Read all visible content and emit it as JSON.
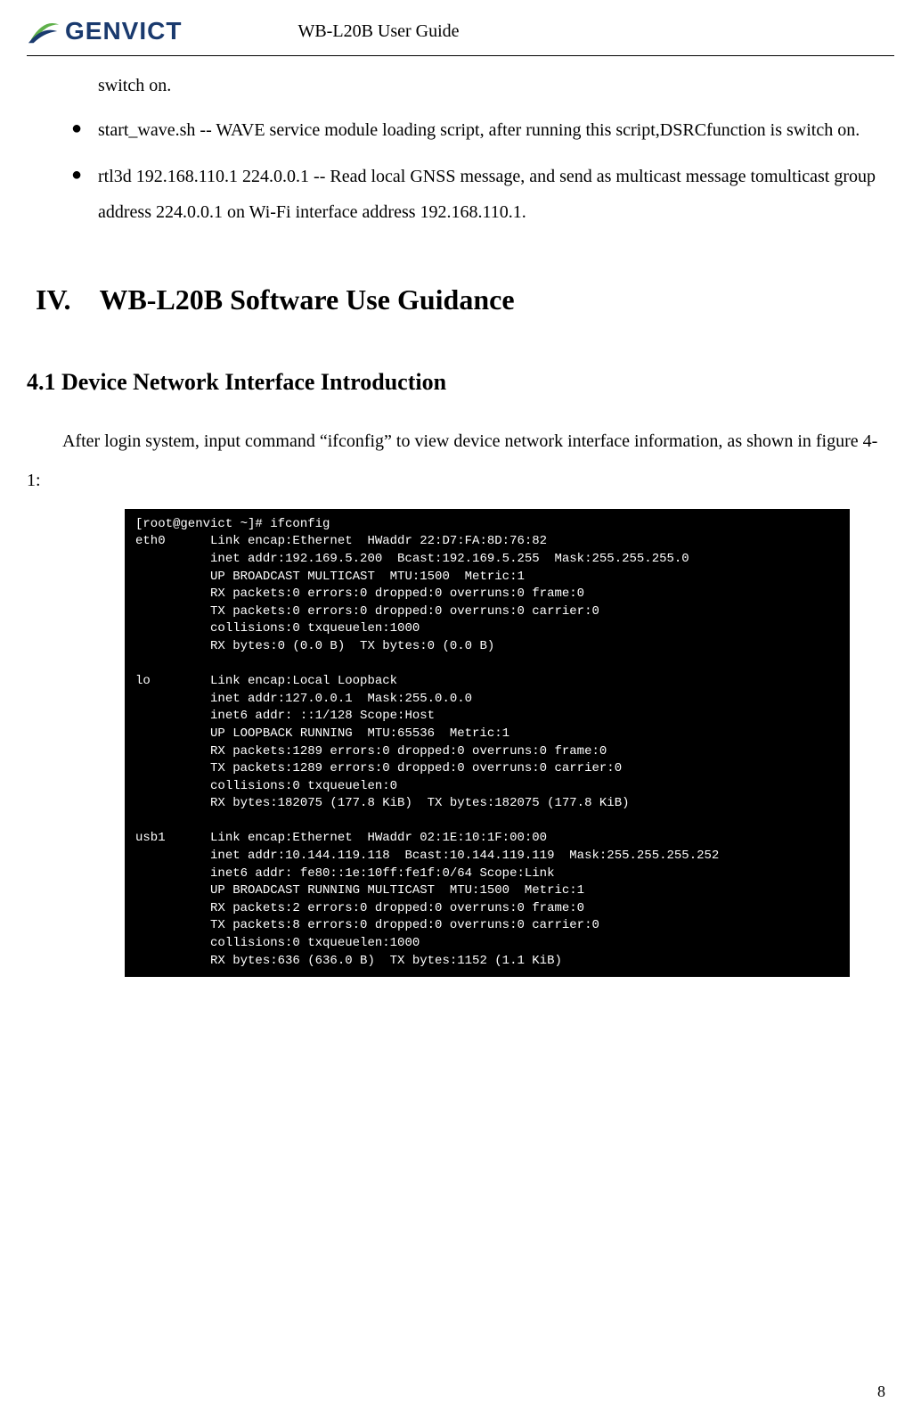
{
  "header": {
    "logo_text": "GENVICT",
    "doc_title": "WB-L20B User Guide"
  },
  "body": {
    "orphan": "switch on.",
    "bullets": [
      "start_wave.sh -- WAVE service module loading script, after running this script,DSRCfunction is switch on.",
      "rtl3d 192.168.110.1 224.0.0.1 -- Read local GNSS message, and send as multicast message tomulticast group address 224.0.0.1 on Wi-Fi interface address 192.168.110.1."
    ],
    "section_heading": "IV. WB-L20B Software Use Guidance",
    "subsection_heading": "4.1 Device Network Interface Introduction",
    "paragraph": "After login system, input command “ifconfig” to view device network interface information, as shown in figure 4-1:"
  },
  "terminal": {
    "prompt": "[root@genvict ~]# ifconfig",
    "interfaces": [
      {
        "name": "eth0",
        "lines": [
          "Link encap:Ethernet  HWaddr 22:D7:FA:8D:76:82",
          "inet addr:192.169.5.200  Bcast:192.169.5.255  Mask:255.255.255.0",
          "UP BROADCAST MULTICAST  MTU:1500  Metric:1",
          "RX packets:0 errors:0 dropped:0 overruns:0 frame:0",
          "TX packets:0 errors:0 dropped:0 overruns:0 carrier:0",
          "collisions:0 txqueuelen:1000",
          "RX bytes:0 (0.0 B)  TX bytes:0 (0.0 B)"
        ]
      },
      {
        "name": "lo",
        "lines": [
          "Link encap:Local Loopback",
          "inet addr:127.0.0.1  Mask:255.0.0.0",
          "inet6 addr: ::1/128 Scope:Host",
          "UP LOOPBACK RUNNING  MTU:65536  Metric:1",
          "RX packets:1289 errors:0 dropped:0 overruns:0 frame:0",
          "TX packets:1289 errors:0 dropped:0 overruns:0 carrier:0",
          "collisions:0 txqueuelen:0",
          "RX bytes:182075 (177.8 KiB)  TX bytes:182075 (177.8 KiB)"
        ]
      },
      {
        "name": "usb1",
        "lines": [
          "Link encap:Ethernet  HWaddr 02:1E:10:1F:00:00",
          "inet addr:10.144.119.118  Bcast:10.144.119.119  Mask:255.255.255.252",
          "inet6 addr: fe80::1e:10ff:fe1f:0/64 Scope:Link",
          "UP BROADCAST RUNNING MULTICAST  MTU:1500  Metric:1",
          "RX packets:2 errors:0 dropped:0 overruns:0 frame:0",
          "TX packets:8 errors:0 dropped:0 overruns:0 carrier:0",
          "collisions:0 txqueuelen:1000",
          "RX bytes:636 (636.0 B)  TX bytes:1152 (1.1 KiB)"
        ]
      }
    ]
  },
  "page_number": "8"
}
